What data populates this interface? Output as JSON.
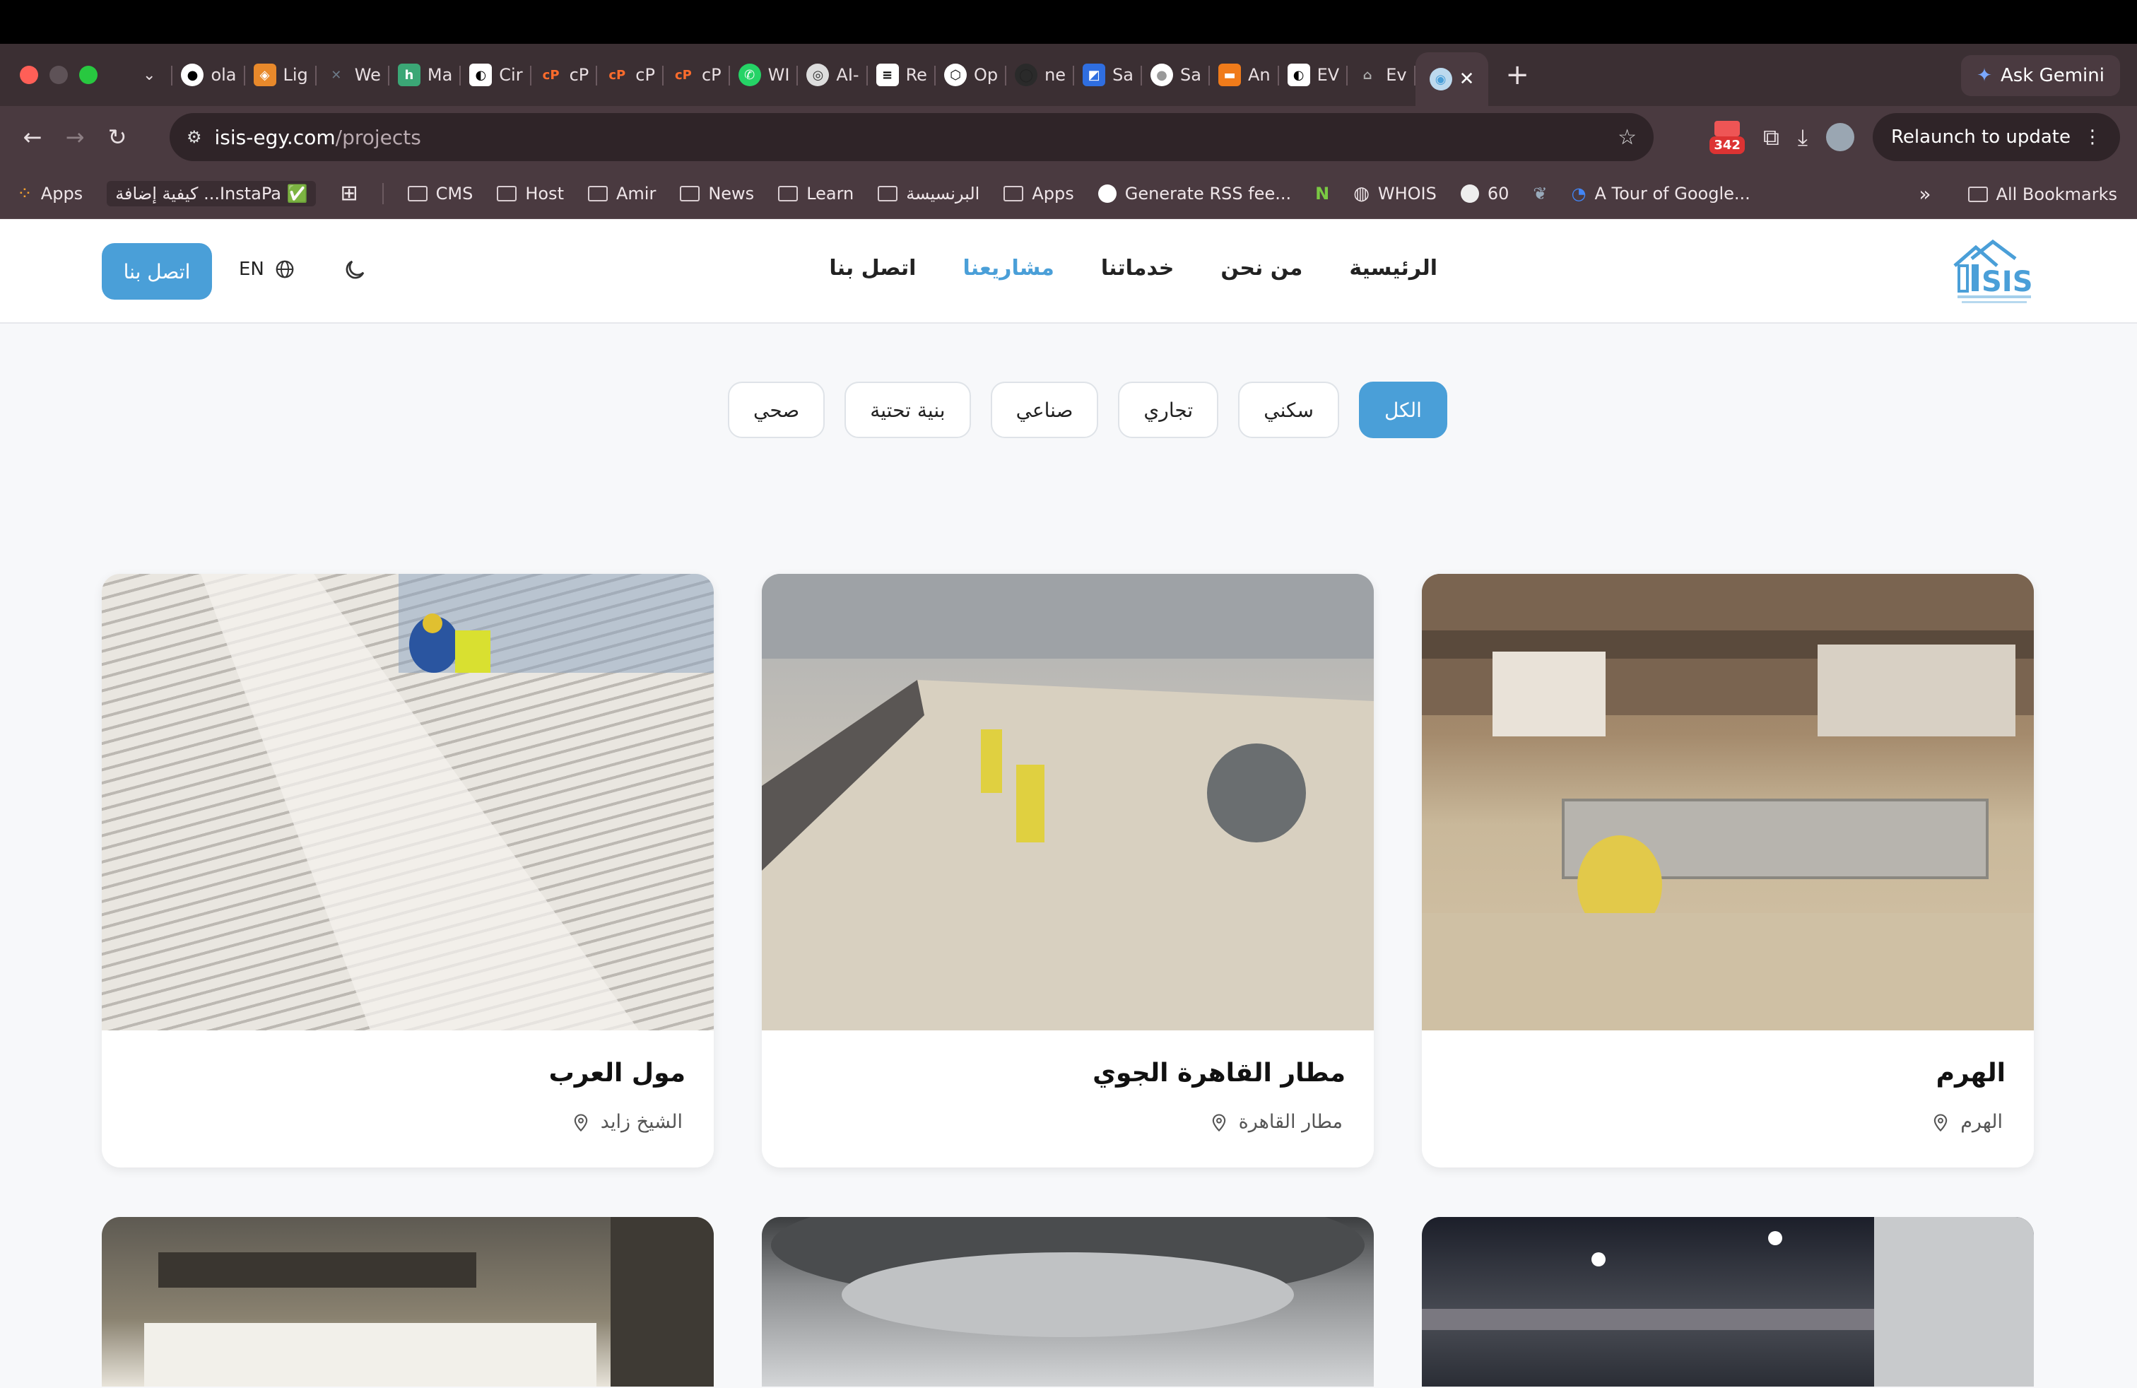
{
  "browser": {
    "tabs": [
      "ola",
      "Lig",
      "We",
      "Ma",
      "Cir",
      "cP",
      "cP",
      "cP",
      "WI",
      "AI-",
      "Re",
      "Op",
      "ne",
      "Sa",
      "Sa",
      "An",
      "EV",
      "Ev"
    ],
    "ask_gemini": "Ask Gemini",
    "url_host": "isis-egy.com",
    "url_path": "/projects",
    "relaunch": "Relaunch to update",
    "ext_badge": "342",
    "bookmarks": [
      "Apps",
      "كيفية إضافة ...InstaPa ✅",
      "CMS",
      "Host",
      "Amir",
      "News",
      "Learn",
      "البرنسيسة",
      "Apps",
      "Generate RSS fee...",
      "WHOIS",
      "60",
      "A Tour of Google..."
    ],
    "all_bookmarks": "All Bookmarks",
    "more_bookmarks": "»"
  },
  "site": {
    "nav": [
      "الرئيسية",
      "من نحن",
      "خدماتنا",
      "مشاريعنا",
      "اتصل بنا"
    ],
    "contact_button": "اتصل بنا",
    "lang": "EN",
    "filters": [
      "الكل",
      "سكني",
      "تجاري",
      "صناعي",
      "بنية تحتية",
      "صحي"
    ],
    "projects": [
      {
        "title": "الهرم",
        "location": "الهرم"
      },
      {
        "title": "مطار القاهرة الجوي",
        "location": "مطار القاهرة"
      },
      {
        "title": "مول العرب",
        "location": "الشيخ زايد"
      }
    ]
  }
}
